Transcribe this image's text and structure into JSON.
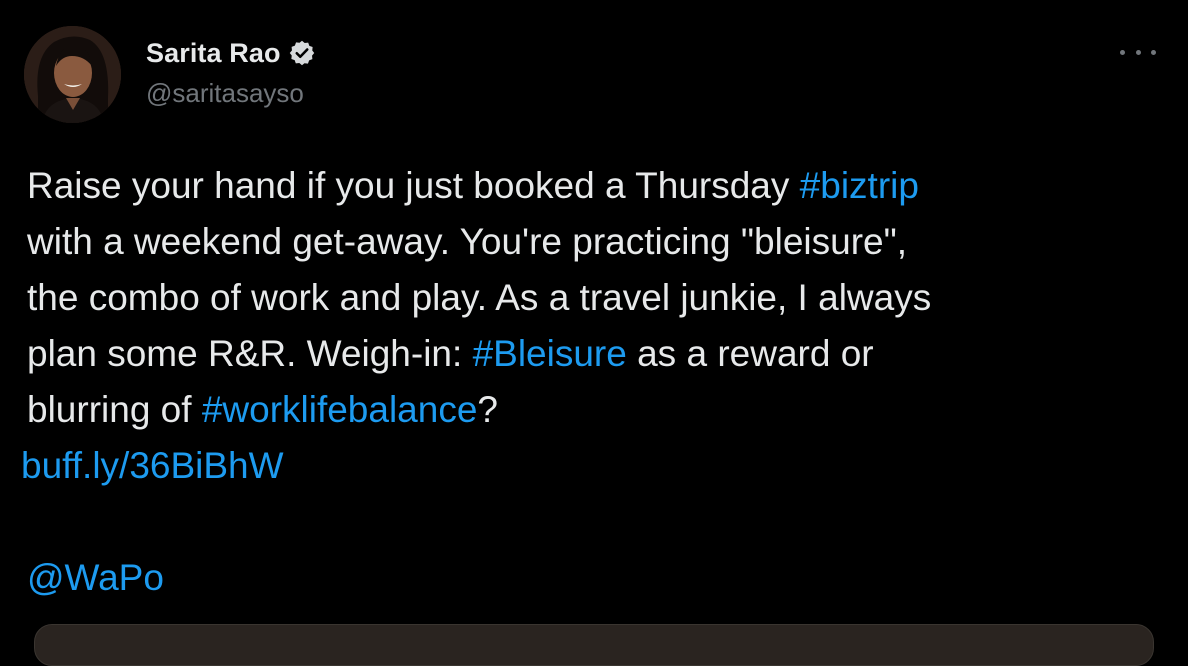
{
  "author": {
    "display_name": "Sarita Rao",
    "handle": "@saritasayso",
    "verified_icon": "verified-badge-icon",
    "avatar_icon": "avatar-photo"
  },
  "more_icon": "more-options-icon",
  "tweet": {
    "line1_text": "Raise your hand if you just booked a Thursday ",
    "line1_tag": "#biztrip",
    "line2_text": "with a weekend get-away. You're practicing \"bleisure\",",
    "line3_text": "the combo of work and play. As a travel junkie, I always",
    "line4_text_a": "plan some R&R. Weigh-in: ",
    "line4_tag": "#Bleisure",
    "line4_text_b": " as a reward or",
    "line5_text_a": "blurring of ",
    "line5_tag": "#worklifebalance",
    "line5_text_b": "?",
    "link": "buff.ly/36BiBhW",
    "mention": "@WaPo"
  },
  "colors": {
    "background": "#000000",
    "text": "#e7e9ea",
    "secondary": "#71767b",
    "accent": "#1d9bf0"
  }
}
